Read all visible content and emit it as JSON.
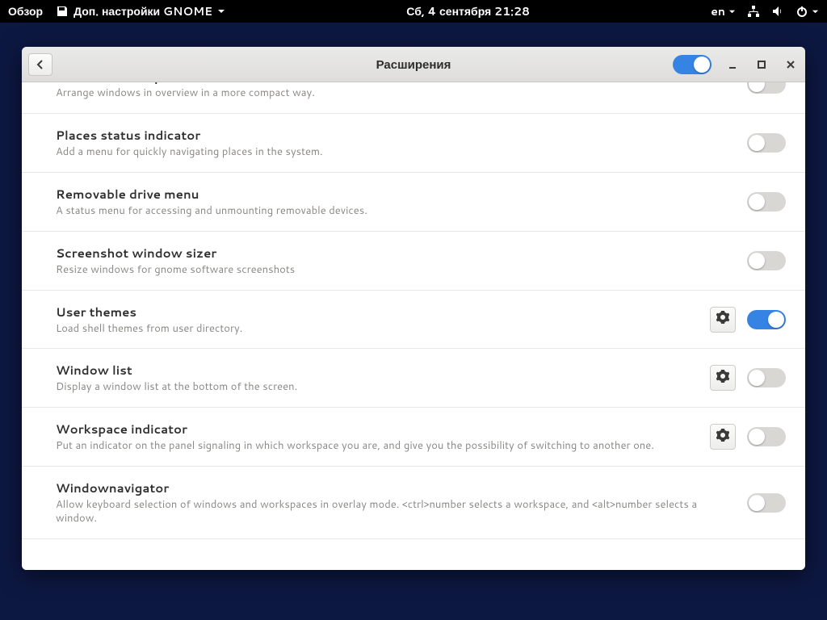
{
  "topbar": {
    "activities": "Обзор",
    "app_name": "Доп. настройки GNOME",
    "clock": "Сб, 4 сентября  21:28",
    "lang": "en"
  },
  "header": {
    "title": "Расширения",
    "master_enabled": true
  },
  "extensions": [
    {
      "title": "Native window placement",
      "desc": "Arrange windows in overview in a more compact way.",
      "enabled": false,
      "has_settings": false,
      "partial_top": true
    },
    {
      "title": "Places status indicator",
      "desc": "Add a menu for quickly navigating places in the system.",
      "enabled": false,
      "has_settings": false
    },
    {
      "title": "Removable drive menu",
      "desc": "A status menu for accessing and unmounting removable devices.",
      "enabled": false,
      "has_settings": false
    },
    {
      "title": "Screenshot window sizer",
      "desc": "Resize windows for gnome software screenshots",
      "enabled": false,
      "has_settings": false
    },
    {
      "title": "User themes",
      "desc": "Load shell themes from user directory.",
      "enabled": true,
      "has_settings": true
    },
    {
      "title": "Window list",
      "desc": "Display a window list at the bottom of the screen.",
      "enabled": false,
      "has_settings": true
    },
    {
      "title": "Workspace indicator",
      "desc": "Put an indicator on the panel signaling in which workspace you are, and give you the possibility of switching to another one.",
      "enabled": false,
      "has_settings": true
    },
    {
      "title": "Windownavigator",
      "desc": "Allow keyboard selection of windows and workspaces in overlay mode. <ctrl>number selects a workspace, and <alt>number selects a window.",
      "enabled": false,
      "has_settings": false
    }
  ]
}
